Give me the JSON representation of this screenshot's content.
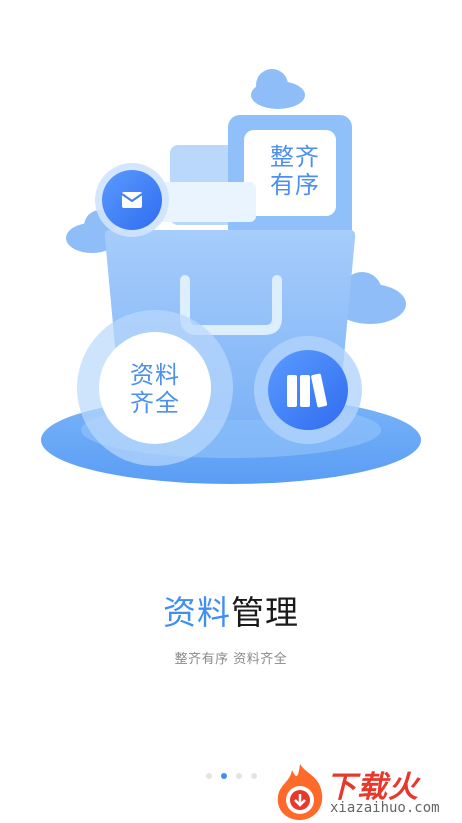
{
  "illustration": {
    "tag_line1": "整齐",
    "tag_line2": "有序",
    "circle_line1": "资料",
    "circle_line2": "齐全"
  },
  "feature": {
    "title_accent": "资料",
    "title_rest": "管理",
    "subtitle": "整齐有序  资料齐全"
  },
  "pager": {
    "total": 4,
    "active_index": 1
  },
  "watermark": {
    "brand": "下载火",
    "url": "xiazaihuo.com"
  },
  "colors": {
    "accent": "#3f8ff2",
    "title_dark": "#1a1a1a",
    "watermark_red": "#e8382b"
  }
}
